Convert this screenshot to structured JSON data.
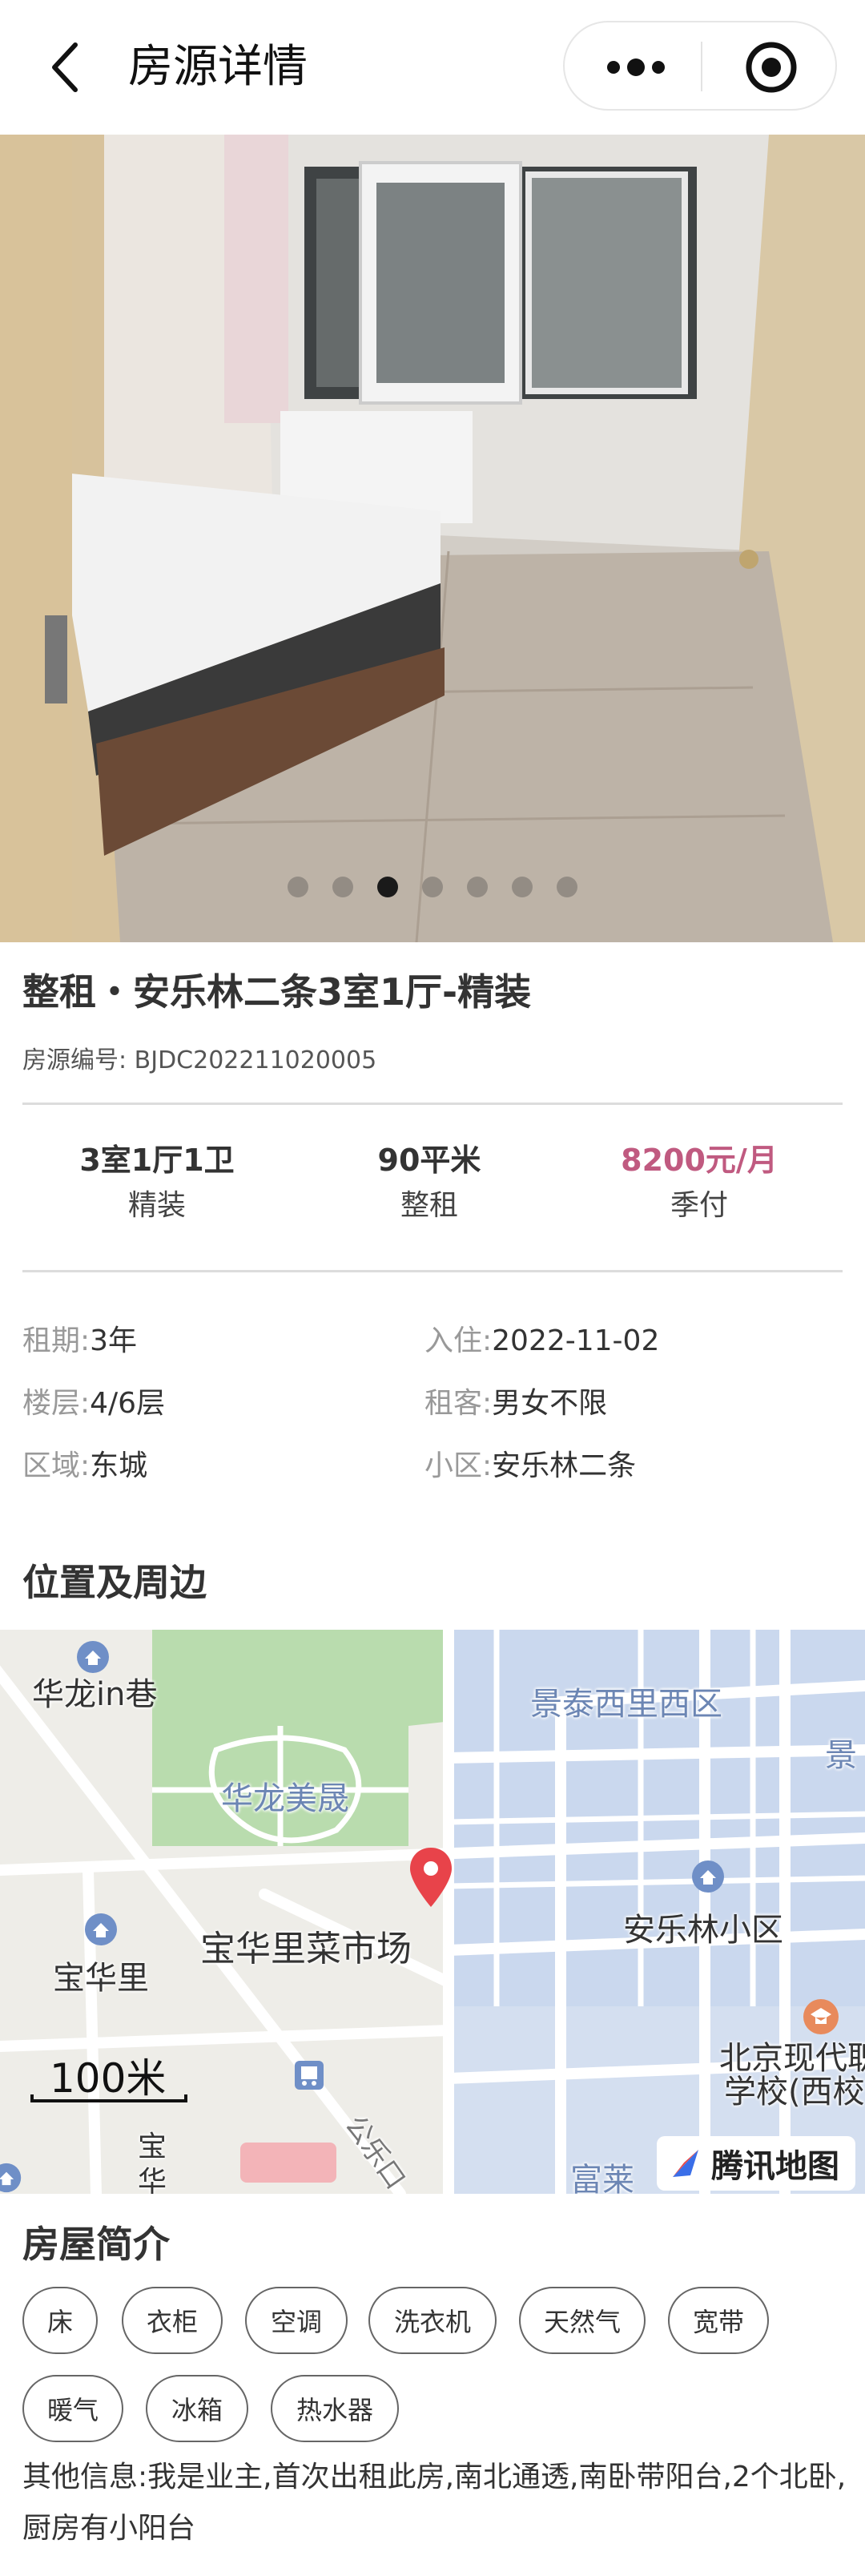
{
  "header": {
    "title": "房源详情",
    "back_icon": "chevron-left-icon",
    "more_icon": "more-dots-icon",
    "target_icon": "target-circle-icon"
  },
  "gallery": {
    "image_count": 7,
    "active_index": 2
  },
  "listing": {
    "title": "整租・安乐林二条3室1厅-精装",
    "code_label": "房源编号:",
    "code_value": "BJDC202211020005"
  },
  "stats": [
    {
      "main": "3室1厅1卫",
      "sub": "精装"
    },
    {
      "main": "90平米",
      "sub": "整租"
    },
    {
      "main": "8200元/月",
      "sub": "季付"
    }
  ],
  "details": [
    {
      "label": "租期:",
      "value": "3年"
    },
    {
      "label": "入住:",
      "value": "2022-11-02"
    },
    {
      "label": "楼层:",
      "value": "4/6层"
    },
    {
      "label": "租客:",
      "value": "男女不限"
    },
    {
      "label": "区域:",
      "value": "东城"
    },
    {
      "label": "小区:",
      "value": "安乐林二条"
    }
  ],
  "location": {
    "title": "位置及周边",
    "map_labels": {
      "hualong_in_xiang": "华龙in巷",
      "jingtai": "景泰西里西区",
      "jing_edge": "景",
      "hualong_meisheng": "华龙美晟",
      "baohuali_market": "宝华里菜市场",
      "anlelin": "安乐林小区",
      "baohuali": "宝华里",
      "beijing_xiandai": "北京现代职",
      "xuexiao": "学校(西校",
      "bao_edge": "宝",
      "hua_edge": "华",
      "fulai": "富莱",
      "road": "公乐口"
    },
    "scale": "100米",
    "provider": "腾讯地图"
  },
  "amenities": {
    "title": "房屋简介",
    "tags": [
      "床",
      "衣柜",
      "空调",
      "洗衣机",
      "天然气",
      "宽带",
      "暖气",
      "冰箱",
      "热水器"
    ],
    "other_info": "其他信息:我是业主,首次出租此房,南北通透,南卧带阳台,2个北卧,厨房有小阳台"
  },
  "colors": {
    "price": "#c05a80",
    "map_water": "#c9d7ee",
    "map_green": "#b8dcab",
    "pin": "#e8434a"
  }
}
